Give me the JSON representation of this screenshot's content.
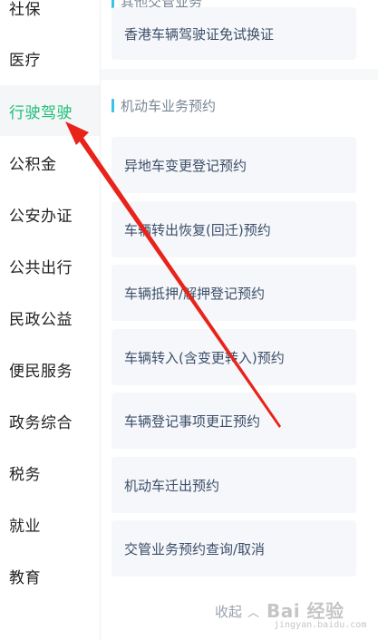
{
  "sidebar": {
    "items": [
      {
        "label": "社保"
      },
      {
        "label": "医疗"
      },
      {
        "label": "行驶驾驶",
        "active": true
      },
      {
        "label": "公积金"
      },
      {
        "label": "公安办证"
      },
      {
        "label": "公共出行"
      },
      {
        "label": "民政公益"
      },
      {
        "label": "便民服务"
      },
      {
        "label": "政务综合"
      },
      {
        "label": "税务"
      },
      {
        "label": "就业"
      },
      {
        "label": "教育"
      }
    ]
  },
  "other_section": {
    "title": "其他交管业务",
    "items": [
      {
        "label": "香港车辆驾驶证免试换证"
      }
    ]
  },
  "vehicle_section": {
    "title": "机动车业务预约",
    "items": [
      {
        "label": "异地车变更登记预约"
      },
      {
        "label": "车辆转出恢复(回迁)预约"
      },
      {
        "label": "车辆抵押/解押登记预约"
      },
      {
        "label": "车辆转入(含变更转入)预约"
      },
      {
        "label": "车辆登记事项更正预约"
      },
      {
        "label": "机动车迁出预约"
      },
      {
        "label": "交管业务预约查询/取消"
      }
    ]
  },
  "collapse": {
    "label": "收起",
    "icon": "chevron-up-icon"
  },
  "watermark": {
    "text": "Bai 经验",
    "sub": "jingyan.baidu.com"
  },
  "colors": {
    "active_text": "#1fbf76",
    "section_bar": "#39c3e8",
    "card_text": "#3d4f6a",
    "annotation_arrow": "#e8231a"
  }
}
